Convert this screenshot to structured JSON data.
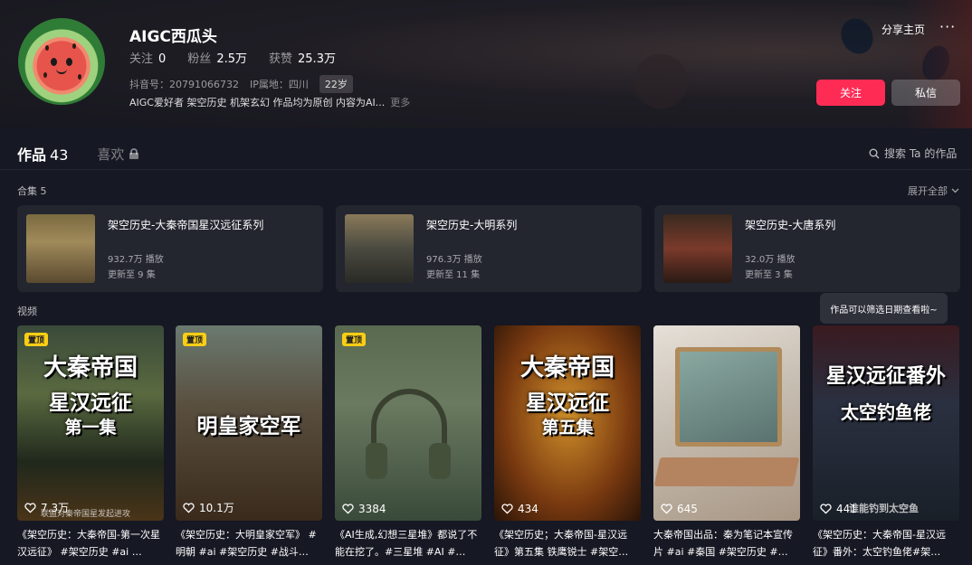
{
  "profile": {
    "username": "AIGC西瓜头",
    "stats": [
      {
        "label": "关注",
        "value": "0"
      },
      {
        "label": "粉丝",
        "value": "2.5万"
      },
      {
        "label": "获赞",
        "value": "25.3万"
      }
    ],
    "douyin_id": "抖音号：20791066732",
    "ip": "IP属地：四川",
    "age": "22岁",
    "bio": "AIGC爱好者 架空历史 机架玄幻 作品均为原创 内容为AI...",
    "bio_more": "更多"
  },
  "header_actions": {
    "share": "分享主页",
    "more": "···",
    "follow": "关注",
    "message": "私信"
  },
  "tabs": {
    "works_label": "作品",
    "works_count": "43",
    "likes_label": "喜欢",
    "search": "搜索 Ta 的作品"
  },
  "collections": {
    "title": "合集 5",
    "expand": "展开全部",
    "items": [
      {
        "title": "架空历史-大秦帝国星汉远征系列",
        "plays": "932.7万 播放",
        "updated": "更新至 9 集"
      },
      {
        "title": "架空历史-大明系列",
        "plays": "976.3万 播放",
        "updated": "更新至 11 集"
      },
      {
        "title": "架空历史-大唐系列",
        "plays": "32.0万 播放",
        "updated": "更新至 3 集"
      }
    ]
  },
  "videos": {
    "title": "视频",
    "tooltip": "作品可以筛选日期查看啦~",
    "pinned_label": "置顶",
    "items": [
      {
        "pinned": true,
        "lines": [
          "大秦帝国",
          "星汉远征",
          "第一集"
        ],
        "likes": "7.3万",
        "caption": "《架空历史：大秦帝国-第一次星汉远征》 #架空历史 #ai …",
        "overlay": "联盟对秦帝国星发起进攻"
      },
      {
        "pinned": true,
        "lines": [
          "",
          "明皇家空军",
          ""
        ],
        "likes": "10.1万",
        "caption": "《架空历史：大明皇家空军》 #明朝 #ai #架空历史 #战斗…",
        "overlay": ""
      },
      {
        "pinned": true,
        "lines": [
          "",
          "",
          ""
        ],
        "likes": "3384",
        "caption": "《AI生成,幻想三星堆》都说了不能在挖了。#三星堆 #AI #…",
        "overlay": ""
      },
      {
        "pinned": false,
        "lines": [
          "大秦帝国",
          "星汉远征",
          "第五集"
        ],
        "likes": "434",
        "caption": "《架空历史；大秦帝国-星汉远征》第五集 铁鹰锐士 #架空…",
        "overlay": ""
      },
      {
        "pinned": false,
        "lines": [
          "",
          "",
          ""
        ],
        "likes": "645",
        "caption": "大秦帝国出品：秦为笔记本宣传片 #ai #秦国 #架空历史 #…",
        "overlay": ""
      },
      {
        "pinned": false,
        "lines": [
          "星汉远征番外",
          "太空钓鱼佬",
          ""
        ],
        "likes": "441",
        "caption": "《架空历史：大秦帝国-星汉远征》番外：太空钓鱼佬#架…",
        "overlay": "谁能钓到太空鱼"
      }
    ]
  }
}
